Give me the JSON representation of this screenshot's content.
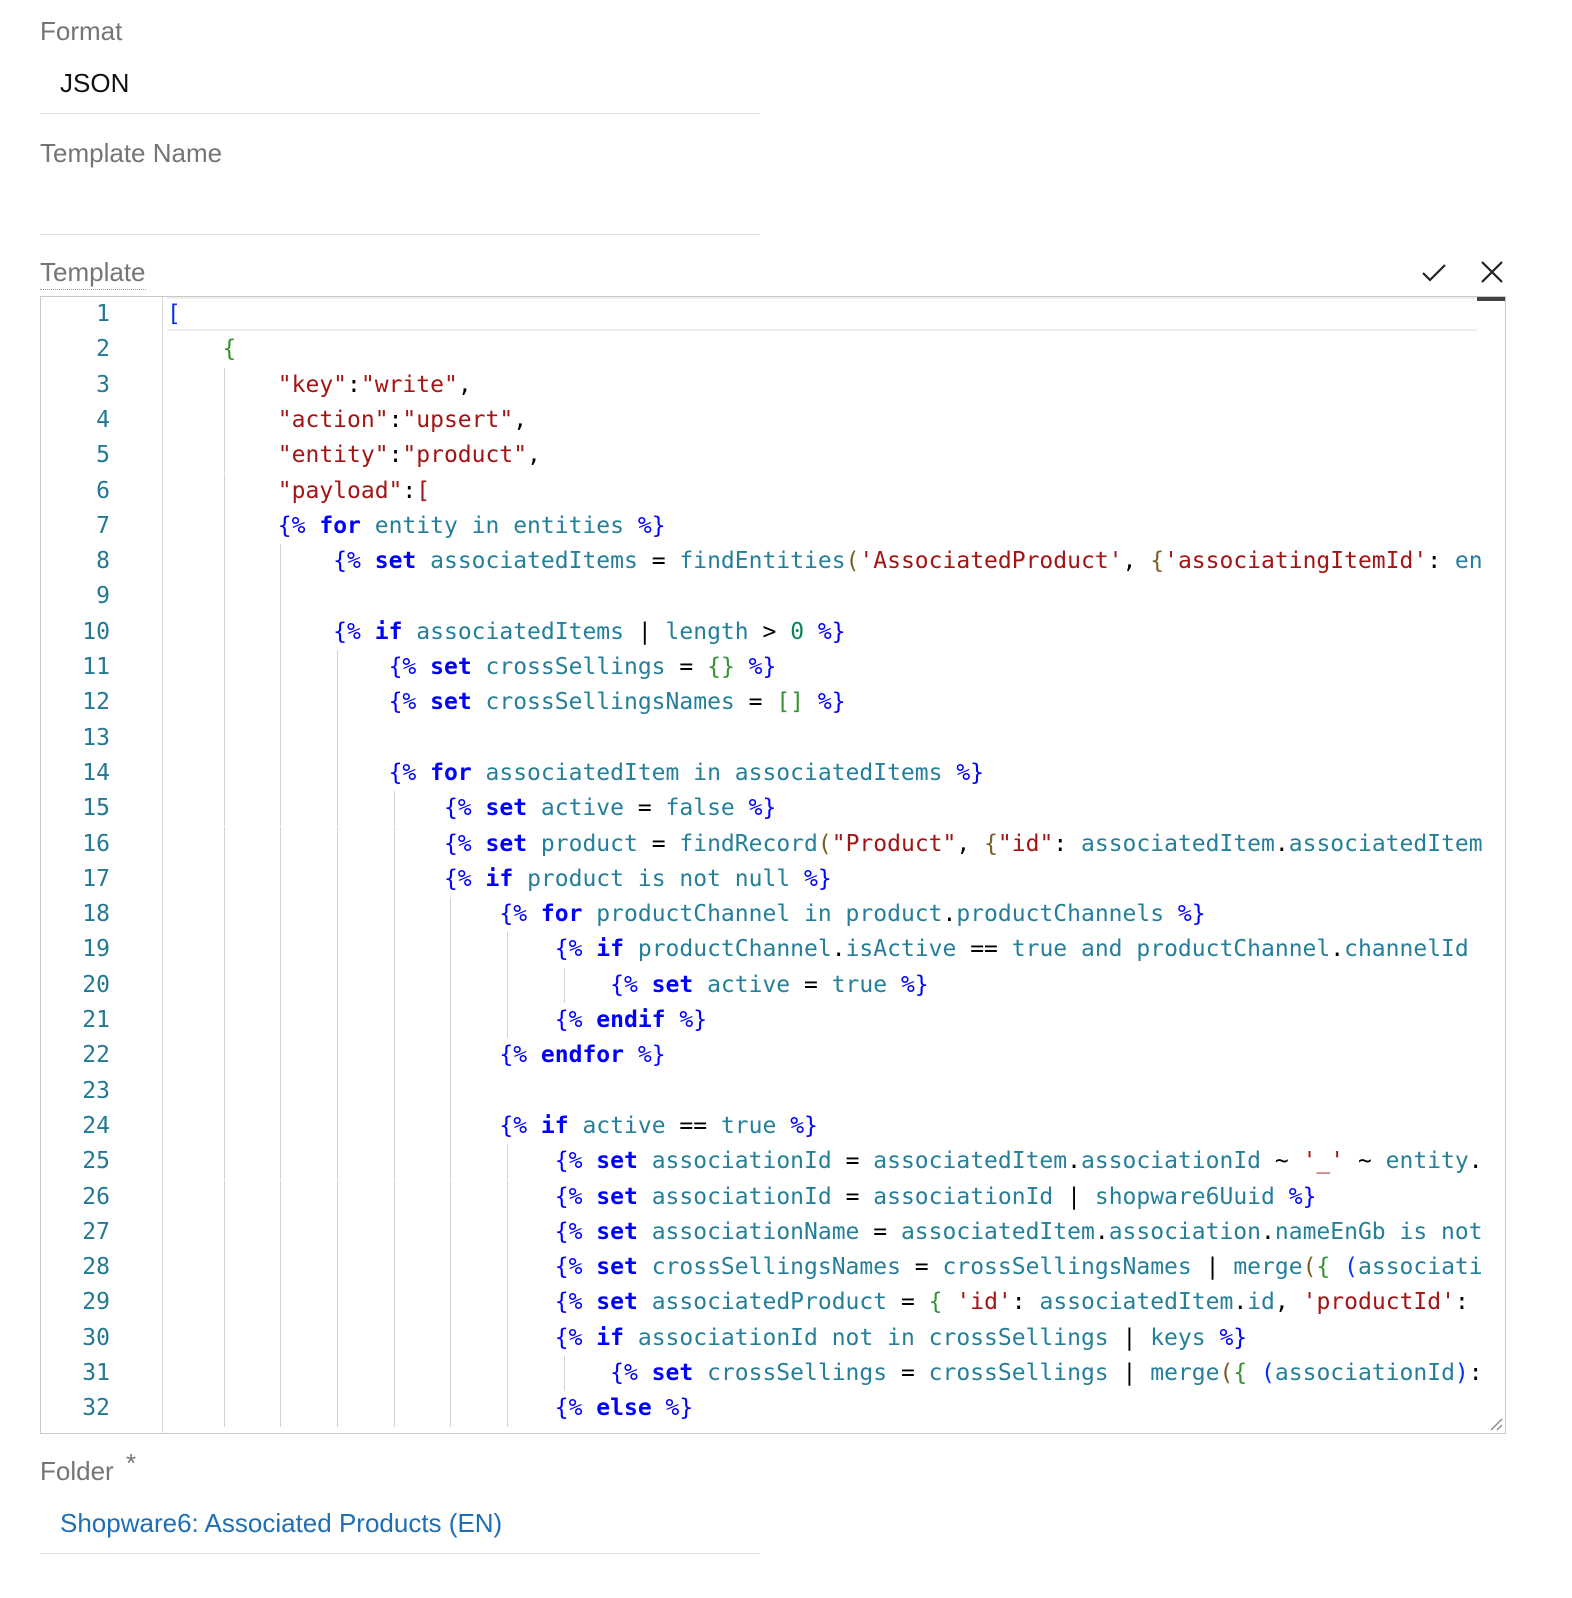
{
  "format": {
    "label": "Format",
    "value": "JSON"
  },
  "template_name": {
    "label": "Template Name",
    "value": ""
  },
  "template": {
    "label": "Template",
    "confirm_icon": "check-icon",
    "cancel_icon": "close-icon",
    "lines": [
      [
        {
          "t": "[",
          "c": "v"
        }
      ],
      [
        {
          "t": "    "
        },
        {
          "t": "{",
          "c": "b"
        }
      ],
      [
        {
          "t": "        "
        },
        {
          "t": "\"key\"",
          "c": "s"
        },
        {
          "t": ":"
        },
        {
          "t": "\"write\"",
          "c": "s"
        },
        {
          "t": ","
        }
      ],
      [
        {
          "t": "        "
        },
        {
          "t": "\"action\"",
          "c": "s"
        },
        {
          "t": ":"
        },
        {
          "t": "\"upsert\"",
          "c": "s"
        },
        {
          "t": ","
        }
      ],
      [
        {
          "t": "        "
        },
        {
          "t": "\"entity\"",
          "c": "s"
        },
        {
          "t": ":"
        },
        {
          "t": "\"product\"",
          "c": "s"
        },
        {
          "t": ","
        }
      ],
      [
        {
          "t": "        "
        },
        {
          "t": "\"payload\"",
          "c": "s"
        },
        {
          "t": ":"
        },
        {
          "t": "[",
          "c": "s"
        }
      ],
      [
        {
          "t": "        "
        },
        {
          "t": "{%",
          "c": "d"
        },
        {
          "t": " "
        },
        {
          "t": "for",
          "c": "k"
        },
        {
          "t": " entity in entities ",
          "c": "i"
        },
        {
          "t": "%}",
          "c": "d"
        }
      ],
      [
        {
          "t": "            "
        },
        {
          "t": "{%",
          "c": "d"
        },
        {
          "t": " "
        },
        {
          "t": "set",
          "c": "k"
        },
        {
          "t": " associatedItems ",
          "c": "i"
        },
        {
          "t": "= "
        },
        {
          "t": "findEntities",
          "c": "i"
        },
        {
          "t": "(",
          "c": "y"
        },
        {
          "t": "'AssociatedProduct'",
          "c": "s"
        },
        {
          "t": ", "
        },
        {
          "t": "{",
          "c": "y"
        },
        {
          "t": "'associatingItemId'",
          "c": "s"
        },
        {
          "t": ": "
        },
        {
          "t": "en",
          "c": "i"
        }
      ],
      [
        {
          "t": ""
        }
      ],
      [
        {
          "t": "            "
        },
        {
          "t": "{%",
          "c": "d"
        },
        {
          "t": " "
        },
        {
          "t": "if",
          "c": "k"
        },
        {
          "t": " associatedItems ",
          "c": "i"
        },
        {
          "t": "| "
        },
        {
          "t": "length",
          "c": "i"
        },
        {
          "t": " > "
        },
        {
          "t": "0",
          "c": "n"
        },
        {
          "t": " "
        },
        {
          "t": "%}",
          "c": "d"
        }
      ],
      [
        {
          "t": "                "
        },
        {
          "t": "{%",
          "c": "d"
        },
        {
          "t": " "
        },
        {
          "t": "set",
          "c": "k"
        },
        {
          "t": " crossSellings ",
          "c": "i"
        },
        {
          "t": "= "
        },
        {
          "t": "{}",
          "c": "b"
        },
        {
          "t": " "
        },
        {
          "t": "%}",
          "c": "d"
        }
      ],
      [
        {
          "t": "                "
        },
        {
          "t": "{%",
          "c": "d"
        },
        {
          "t": " "
        },
        {
          "t": "set",
          "c": "k"
        },
        {
          "t": " crossSellingsNames ",
          "c": "i"
        },
        {
          "t": "= "
        },
        {
          "t": "[]",
          "c": "b"
        },
        {
          "t": " "
        },
        {
          "t": "%}",
          "c": "d"
        }
      ],
      [
        {
          "t": ""
        }
      ],
      [
        {
          "t": "                "
        },
        {
          "t": "{%",
          "c": "d"
        },
        {
          "t": " "
        },
        {
          "t": "for",
          "c": "k"
        },
        {
          "t": " associatedItem in associatedItems ",
          "c": "i"
        },
        {
          "t": "%}",
          "c": "d"
        }
      ],
      [
        {
          "t": "                    "
        },
        {
          "t": "{%",
          "c": "d"
        },
        {
          "t": " "
        },
        {
          "t": "set",
          "c": "k"
        },
        {
          "t": " active ",
          "c": "i"
        },
        {
          "t": "= "
        },
        {
          "t": "false",
          "c": "i"
        },
        {
          "t": " "
        },
        {
          "t": "%}",
          "c": "d"
        }
      ],
      [
        {
          "t": "                    "
        },
        {
          "t": "{%",
          "c": "d"
        },
        {
          "t": " "
        },
        {
          "t": "set",
          "c": "k"
        },
        {
          "t": " product ",
          "c": "i"
        },
        {
          "t": "= "
        },
        {
          "t": "findRecord",
          "c": "i"
        },
        {
          "t": "(",
          "c": "y"
        },
        {
          "t": "\"Product\"",
          "c": "s"
        },
        {
          "t": ", "
        },
        {
          "t": "{",
          "c": "y"
        },
        {
          "t": "\"id\"",
          "c": "s"
        },
        {
          "t": ": "
        },
        {
          "t": "associatedItem",
          "c": "i"
        },
        {
          "t": "."
        },
        {
          "t": "associatedItem",
          "c": "i"
        }
      ],
      [
        {
          "t": "                    "
        },
        {
          "t": "{%",
          "c": "d"
        },
        {
          "t": " "
        },
        {
          "t": "if",
          "c": "k"
        },
        {
          "t": " product is not null ",
          "c": "i"
        },
        {
          "t": "%}",
          "c": "d"
        }
      ],
      [
        {
          "t": "                        "
        },
        {
          "t": "{%",
          "c": "d"
        },
        {
          "t": " "
        },
        {
          "t": "for",
          "c": "k"
        },
        {
          "t": " productChannel in product",
          "c": "i"
        },
        {
          "t": "."
        },
        {
          "t": "productChannels ",
          "c": "i"
        },
        {
          "t": "%}",
          "c": "d"
        }
      ],
      [
        {
          "t": "                            "
        },
        {
          "t": "{%",
          "c": "d"
        },
        {
          "t": " "
        },
        {
          "t": "if",
          "c": "k"
        },
        {
          "t": " productChannel",
          "c": "i"
        },
        {
          "t": "."
        },
        {
          "t": "isActive ",
          "c": "i"
        },
        {
          "t": "== "
        },
        {
          "t": "true and productChannel",
          "c": "i"
        },
        {
          "t": "."
        },
        {
          "t": "channelId",
          "c": "i"
        }
      ],
      [
        {
          "t": "                                "
        },
        {
          "t": "{%",
          "c": "d"
        },
        {
          "t": " "
        },
        {
          "t": "set",
          "c": "k"
        },
        {
          "t": " active ",
          "c": "i"
        },
        {
          "t": "= "
        },
        {
          "t": "true",
          "c": "i"
        },
        {
          "t": " "
        },
        {
          "t": "%}",
          "c": "d"
        }
      ],
      [
        {
          "t": "                            "
        },
        {
          "t": "{%",
          "c": "d"
        },
        {
          "t": " "
        },
        {
          "t": "endif",
          "c": "k"
        },
        {
          "t": " "
        },
        {
          "t": "%}",
          "c": "d"
        }
      ],
      [
        {
          "t": "                        "
        },
        {
          "t": "{%",
          "c": "d"
        },
        {
          "t": " "
        },
        {
          "t": "endfor",
          "c": "k"
        },
        {
          "t": " "
        },
        {
          "t": "%}",
          "c": "d"
        }
      ],
      [
        {
          "t": ""
        }
      ],
      [
        {
          "t": "                        "
        },
        {
          "t": "{%",
          "c": "d"
        },
        {
          "t": " "
        },
        {
          "t": "if",
          "c": "k"
        },
        {
          "t": " active ",
          "c": "i"
        },
        {
          "t": "== "
        },
        {
          "t": "true",
          "c": "i"
        },
        {
          "t": " "
        },
        {
          "t": "%}",
          "c": "d"
        }
      ],
      [
        {
          "t": "                            "
        },
        {
          "t": "{%",
          "c": "d"
        },
        {
          "t": " "
        },
        {
          "t": "set",
          "c": "k"
        },
        {
          "t": " associationId ",
          "c": "i"
        },
        {
          "t": "= "
        },
        {
          "t": "associatedItem",
          "c": "i"
        },
        {
          "t": "."
        },
        {
          "t": "associationId ",
          "c": "i"
        },
        {
          "t": "~ "
        },
        {
          "t": "'_'",
          "c": "s"
        },
        {
          "t": " ~ "
        },
        {
          "t": "entity",
          "c": "i"
        },
        {
          "t": "."
        }
      ],
      [
        {
          "t": "                            "
        },
        {
          "t": "{%",
          "c": "d"
        },
        {
          "t": " "
        },
        {
          "t": "set",
          "c": "k"
        },
        {
          "t": " associationId ",
          "c": "i"
        },
        {
          "t": "= "
        },
        {
          "t": "associationId ",
          "c": "i"
        },
        {
          "t": "| "
        },
        {
          "t": "shopware6Uuid ",
          "c": "i"
        },
        {
          "t": "%}",
          "c": "d"
        }
      ],
      [
        {
          "t": "                            "
        },
        {
          "t": "{%",
          "c": "d"
        },
        {
          "t": " "
        },
        {
          "t": "set",
          "c": "k"
        },
        {
          "t": " associationName ",
          "c": "i"
        },
        {
          "t": "= "
        },
        {
          "t": "associatedItem",
          "c": "i"
        },
        {
          "t": "."
        },
        {
          "t": "association",
          "c": "i"
        },
        {
          "t": "."
        },
        {
          "t": "nameEnGb is not",
          "c": "i"
        }
      ],
      [
        {
          "t": "                            "
        },
        {
          "t": "{%",
          "c": "d"
        },
        {
          "t": " "
        },
        {
          "t": "set",
          "c": "k"
        },
        {
          "t": " crossSellingsNames ",
          "c": "i"
        },
        {
          "t": "= "
        },
        {
          "t": "crossSellingsNames ",
          "c": "i"
        },
        {
          "t": "| "
        },
        {
          "t": "merge",
          "c": "i"
        },
        {
          "t": "(",
          "c": "y"
        },
        {
          "t": "{",
          "c": "b"
        },
        {
          "t": " "
        },
        {
          "t": "(",
          "c": "v"
        },
        {
          "t": "associati",
          "c": "i"
        }
      ],
      [
        {
          "t": "                            "
        },
        {
          "t": "{%",
          "c": "d"
        },
        {
          "t": " "
        },
        {
          "t": "set",
          "c": "k"
        },
        {
          "t": " associatedProduct ",
          "c": "i"
        },
        {
          "t": "= "
        },
        {
          "t": "{",
          "c": "b"
        },
        {
          "t": " "
        },
        {
          "t": "'id'",
          "c": "s"
        },
        {
          "t": ": "
        },
        {
          "t": "associatedItem",
          "c": "i"
        },
        {
          "t": "."
        },
        {
          "t": "id",
          "c": "i"
        },
        {
          "t": ", "
        },
        {
          "t": "'productId'",
          "c": "s"
        },
        {
          "t": ":"
        }
      ],
      [
        {
          "t": "                            "
        },
        {
          "t": "{%",
          "c": "d"
        },
        {
          "t": " "
        },
        {
          "t": "if",
          "c": "k"
        },
        {
          "t": " associationId not in crossSellings ",
          "c": "i"
        },
        {
          "t": "| "
        },
        {
          "t": "keys ",
          "c": "i"
        },
        {
          "t": "%}",
          "c": "d"
        }
      ],
      [
        {
          "t": "                                "
        },
        {
          "t": "{%",
          "c": "d"
        },
        {
          "t": " "
        },
        {
          "t": "set",
          "c": "k"
        },
        {
          "t": " crossSellings ",
          "c": "i"
        },
        {
          "t": "= "
        },
        {
          "t": "crossSellings ",
          "c": "i"
        },
        {
          "t": "| "
        },
        {
          "t": "merge",
          "c": "i"
        },
        {
          "t": "(",
          "c": "y"
        },
        {
          "t": "{",
          "c": "b"
        },
        {
          "t": " "
        },
        {
          "t": "(",
          "c": "v"
        },
        {
          "t": "associationId",
          "c": "i"
        },
        {
          "t": ")",
          "c": "v"
        },
        {
          "t": ":"
        }
      ],
      [
        {
          "t": "                            "
        },
        {
          "t": "{%",
          "c": "d"
        },
        {
          "t": " "
        },
        {
          "t": "else",
          "c": "k"
        },
        {
          "t": " "
        },
        {
          "t": "%}",
          "c": "d"
        }
      ]
    ]
  },
  "folder": {
    "label": "Folder",
    "required_mark": "*",
    "value": "Shopware6: Associated Products (EN)"
  }
}
